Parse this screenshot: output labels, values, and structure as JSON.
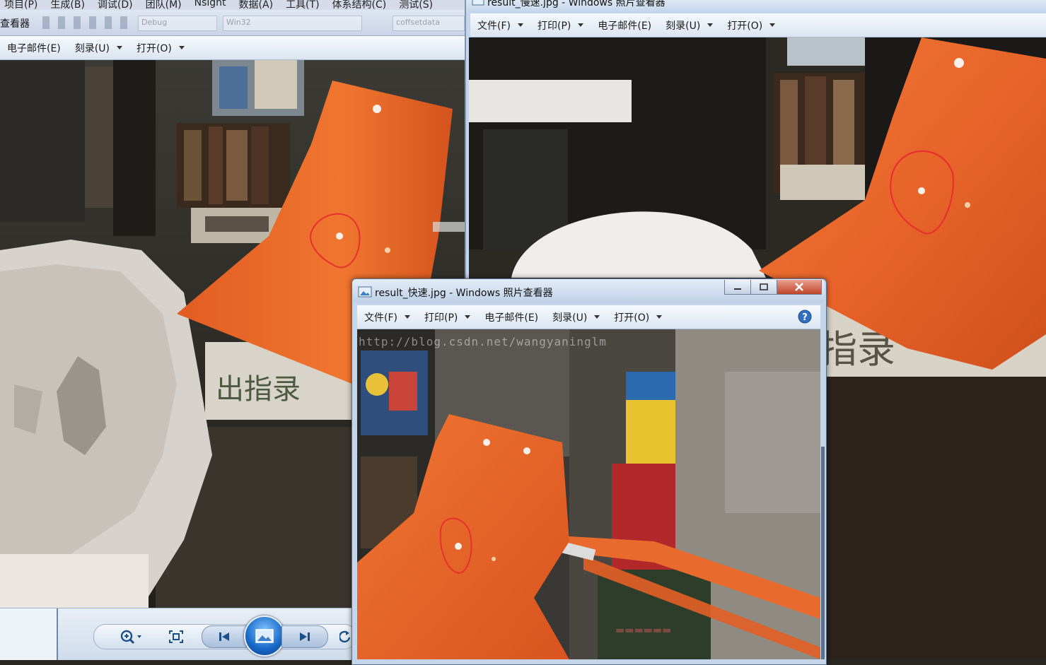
{
  "vs_menu": {
    "items": [
      "项目(P)",
      "生成(B)",
      "调试(D)",
      "团队(M)",
      "Nsight",
      "数据(A)",
      "工具(T)",
      "体系结构(C)",
      "测试(S)"
    ],
    "toolbar_config": "Debug",
    "toolbar_platform": "Win32",
    "toolbar_extra": "coffsetdata"
  },
  "left_viewer": {
    "title_fragment": "查看器",
    "menu": [
      {
        "label": "电子邮件(E)",
        "caret": false
      },
      {
        "label": "刻录(U)",
        "caret": true
      },
      {
        "label": "打开(O)",
        "caret": true
      }
    ]
  },
  "right_viewer": {
    "title": "result_慢速.jpg - Windows 照片查看器",
    "menu": [
      {
        "label": "文件(F)",
        "caret": true
      },
      {
        "label": "打印(P)",
        "caret": true
      },
      {
        "label": "电子邮件(E)",
        "caret": false
      },
      {
        "label": "刻录(U)",
        "caret": true
      },
      {
        "label": "打开(O)",
        "caret": true
      }
    ]
  },
  "front_viewer": {
    "title": "result_快速.jpg - Windows 照片查看器",
    "menu": [
      {
        "label": "文件(F)",
        "caret": true
      },
      {
        "label": "打印(P)",
        "caret": true
      },
      {
        "label": "电子邮件(E)",
        "caret": false
      },
      {
        "label": "刻录(U)",
        "caret": true
      },
      {
        "label": "打开(O)",
        "caret": true
      }
    ],
    "watermark": "http://blog.csdn.net/wangyaninglm",
    "caption_buttons": [
      "minimize",
      "maximize",
      "close"
    ]
  },
  "icons": {
    "zoom": "zoom-icon",
    "fit": "fit-window-icon",
    "previous": "previous-icon",
    "slideshow": "slideshow-icon",
    "next": "next-icon",
    "rotate": "rotate-icon",
    "help": "help-icon",
    "window": "photo-viewer-window-icon"
  },
  "colors": {
    "lamp_orange": "#e8622a",
    "annotation_red": "#e83030",
    "aero_blue": "#c6d6ea"
  }
}
